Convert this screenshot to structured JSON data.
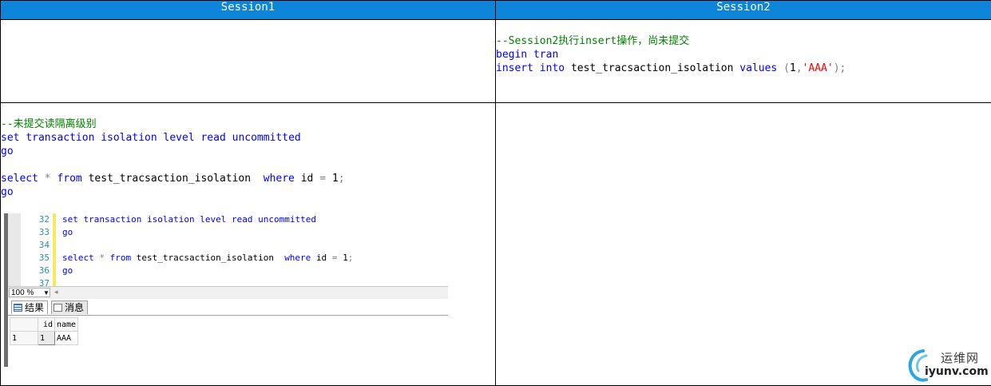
{
  "columns": [
    "Session1",
    "Session2"
  ],
  "session2_code": {
    "comment": "--Session2执行insert操作，尚未提交",
    "kw_begin": "begin",
    "kw_tran": "tran",
    "kw_insert": "insert",
    "kw_into": "into",
    "table": "test_tracsaction_isolation",
    "kw_values": "values",
    "paren_open": "(",
    "num": "1",
    "comma": ",",
    "str": "'AAA'",
    "paren_close": ");"
  },
  "session1_code": {
    "comment": "--未提交读隔离级别",
    "kw_set": "set",
    "kw_transaction": "transaction",
    "kw_isolation": "isolation",
    "kw_level": "level",
    "kw_read": "read",
    "kw_uncommitted": "uncommitted",
    "kw_go1": "go",
    "kw_select": "select",
    "star": "*",
    "kw_from": "from",
    "table": "test_tracsaction_isolation",
    "kw_where": "where",
    "col": "id",
    "eq": "=",
    "num": "1",
    "semi": ";",
    "kw_go2": "go"
  },
  "ssms": {
    "line_numbers": [
      "32",
      "33",
      "34",
      "35",
      "36",
      "37"
    ],
    "editor": {
      "set": "set",
      "transaction": "transaction",
      "isolation": "isolation",
      "level": "level",
      "read": "read",
      "uncommitted": "uncommitted",
      "go1": "go",
      "select": "select",
      "star": "*",
      "from": "from",
      "table": "test_tracsaction_isolation",
      "where": "where",
      "col": "id",
      "eq": "=",
      "num": "1",
      "semi": ";",
      "go2": "go"
    },
    "zoom": "100 %",
    "tabs": {
      "results": "结果",
      "messages": "消息"
    },
    "results": {
      "headers": [
        "id",
        "name"
      ],
      "rows": [
        {
          "rownum": "1",
          "id": "1",
          "name": "AAA"
        }
      ]
    }
  },
  "watermark": {
    "cn": "运维网",
    "en": "iyunv.com"
  },
  "colors": {
    "header_bg": "#0d85d8",
    "keyword": "#0000ff",
    "comment": "#008000",
    "string": "#ff0000"
  }
}
